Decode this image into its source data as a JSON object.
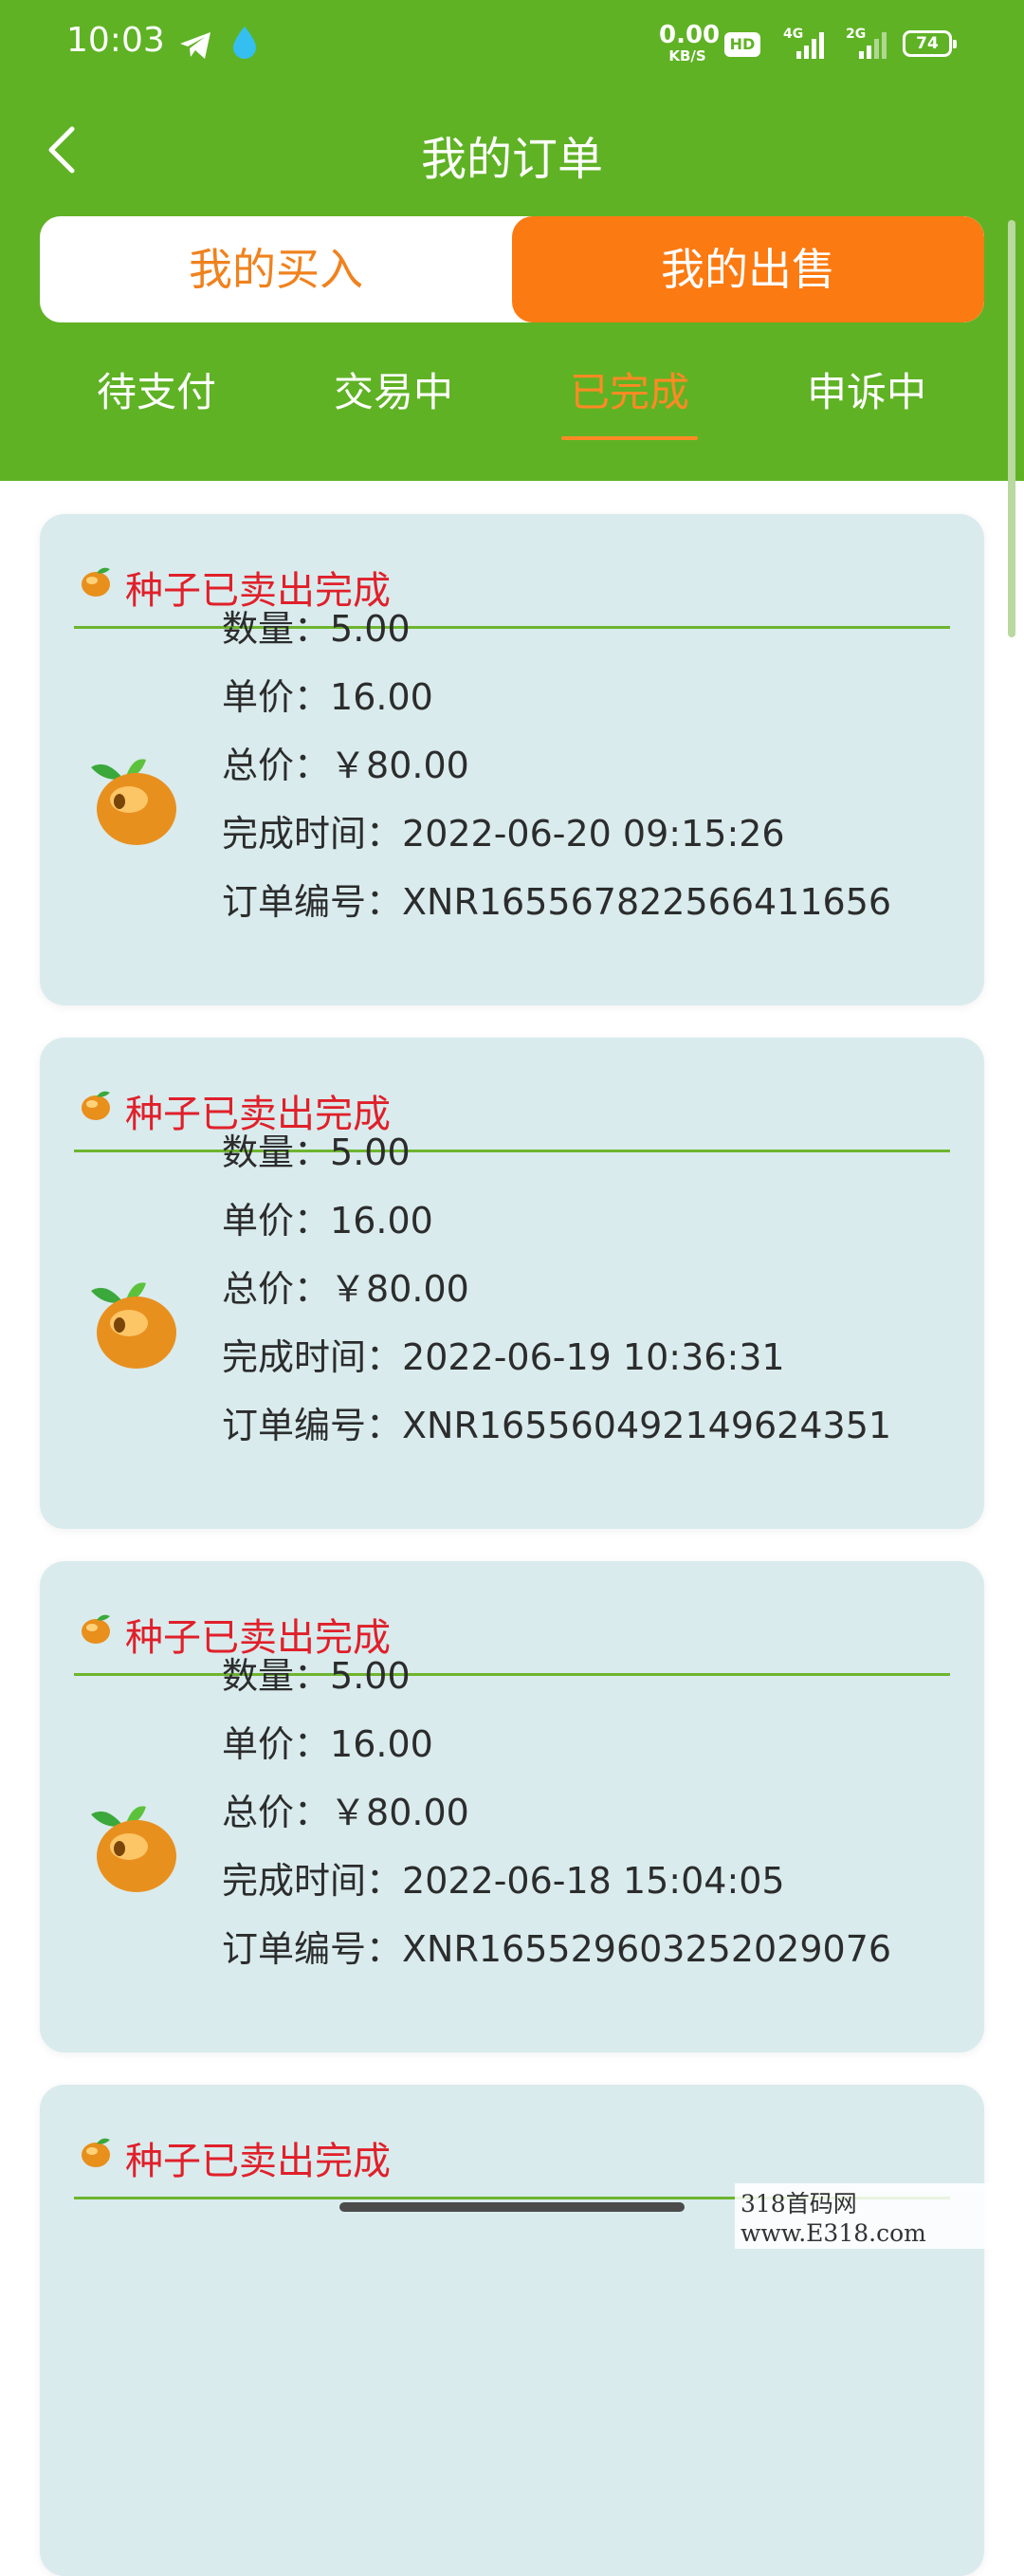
{
  "status_bar": {
    "time": "10:03",
    "net_speed_value": "0.00",
    "net_speed_unit": "KB/S",
    "hd": "HD",
    "signal1": "4G",
    "signal2": "2G",
    "battery": "74"
  },
  "header": {
    "title": "我的订单"
  },
  "segment": {
    "buy": "我的买入",
    "sell": "我的出售"
  },
  "tabs": [
    {
      "label": "待支付"
    },
    {
      "label": "交易中"
    },
    {
      "label": "已完成",
      "active": true
    },
    {
      "label": "申诉中"
    }
  ],
  "labels": {
    "qty": "数量：",
    "unit_price": "单价：",
    "total": "总价：",
    "time": "完成时间：",
    "order_no": "订单编号："
  },
  "orders": [
    {
      "title": "种子已卖出完成",
      "qty": "5.00",
      "unit_price": "16.00",
      "total": "￥80.00",
      "time": "2022-06-20 09:15:26",
      "order_no": "XNR165567822566411656"
    },
    {
      "title": "种子已卖出完成",
      "qty": "5.00",
      "unit_price": "16.00",
      "total": "￥80.00",
      "time": "2022-06-19 10:36:31",
      "order_no": "XNR165560492149624351"
    },
    {
      "title": "种子已卖出完成",
      "qty": "5.00",
      "unit_price": "16.00",
      "total": "￥80.00",
      "time": "2022-06-18 15:04:05",
      "order_no": "XNR165529603252029076"
    },
    {
      "title": "种子已卖出完成"
    }
  ],
  "watermark": "318首码网 www.E318.com",
  "colors": {
    "header_green": "#5fb224",
    "accent_orange": "#fc7a12",
    "card_bg": "#d9ebed",
    "title_red": "#e0202a"
  }
}
